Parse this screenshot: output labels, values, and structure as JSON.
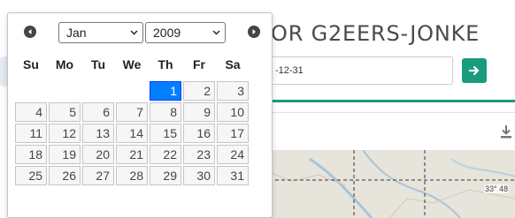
{
  "page": {
    "title": "OR G2EERS-JONKE",
    "date_value": "-12-31",
    "go_icon": "arrow-right-icon",
    "download_icon": "download-icon",
    "map_coord_label": "33° 48",
    "colors": {
      "accent": "#1a9b7e",
      "selected_day": "#007fff"
    }
  },
  "datepicker": {
    "prev_icon": "circle-triangle-left-icon",
    "next_icon": "circle-triangle-right-icon",
    "month": "Jan",
    "year": "2009",
    "weekdays": [
      "Su",
      "Mo",
      "Tu",
      "We",
      "Th",
      "Fr",
      "Sa"
    ],
    "weeks": [
      [
        "",
        "",
        "",
        "",
        "1",
        "2",
        "3"
      ],
      [
        "4",
        "5",
        "6",
        "7",
        "8",
        "9",
        "10"
      ],
      [
        "11",
        "12",
        "13",
        "14",
        "15",
        "16",
        "17"
      ],
      [
        "18",
        "19",
        "20",
        "21",
        "22",
        "23",
        "24"
      ],
      [
        "25",
        "26",
        "27",
        "28",
        "29",
        "30",
        "31"
      ]
    ],
    "selected_day": "1"
  }
}
